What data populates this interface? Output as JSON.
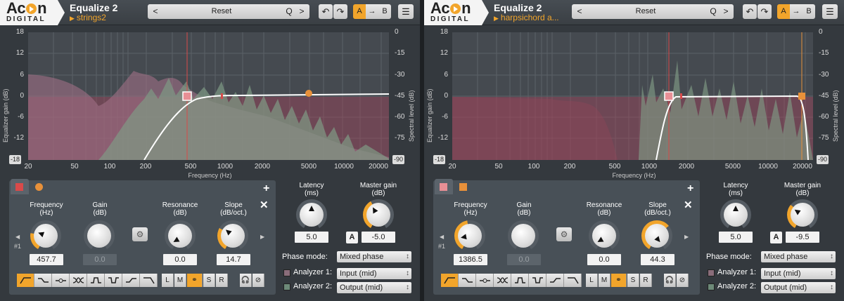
{
  "colors": {
    "accent": "#f2a52b",
    "band1": "#d94a4a",
    "band2": "#e8913a",
    "band1_light": "#e88f95",
    "band2_light": "#e8913a",
    "spectrum_input": "#8a6d7a",
    "spectrum_output": "#6d8a78"
  },
  "scales": {
    "gain_ticks": [
      "18",
      "12",
      "6",
      "0",
      "-6",
      "-12"
    ],
    "gain_bottom": "-18",
    "spectral_ticks": [
      "0",
      "-15",
      "-30",
      "-45",
      "-60",
      "-75"
    ],
    "spectral_bottom": "-90",
    "freq_ticks": [
      "20",
      "50",
      "100",
      "200",
      "500",
      "1000",
      "2000",
      "5000",
      "10000",
      "20000"
    ],
    "gain_axis_label": "Equalizer gain (dB)",
    "spectral_axis_label": "Spectral level (dB)",
    "freq_axis_label": "Frequency (Hz)"
  },
  "common": {
    "logo_main_a": "Ac",
    "logo_main_b": "n",
    "logo_sub": "DIGITAL",
    "app_title": "Equalize 2",
    "reset_label": "Reset",
    "prev_icon": "<",
    "next_icon": ">",
    "search_icon": "Q",
    "undo_icon": "↶",
    "redo_icon": "↷",
    "ab_a": "A",
    "ab_arrow": "→",
    "ab_b": "B",
    "menu_icon": "☰",
    "add_icon": "+",
    "close_icon": "✕",
    "freq_label": "Frequency\n(Hz)",
    "gain_label": "Gain\n(dB)",
    "res_label": "Resonance\n(dB)",
    "slope_label": "Slope\n(dB/oct.)",
    "latency_label": "Latency\n(ms)",
    "master_label": "Master gain\n(dB)",
    "phase_mode_label": "Phase mode:",
    "analyzer1_label": "Analyzer 1:",
    "analyzer2_label": "Analyzer 2:",
    "band_index": "#1",
    "channel_buttons": [
      "L",
      "M",
      "⚭",
      "S",
      "R"
    ],
    "gear_icon": "⚙",
    "a_button": "A",
    "nav_left": "◀",
    "nav_right": "▶"
  },
  "left": {
    "preset": "strings2",
    "frequency": "457.7",
    "gain": "0.0",
    "resonance": "0.0",
    "slope": "14.7",
    "latency": "5.0",
    "master_gain": "-5.0",
    "phase_mode": "Mixed phase",
    "analyzer1": "Input (mid)",
    "analyzer2": "Output (mid)"
  },
  "right": {
    "preset": "harpsichord a...",
    "frequency": "1386.5",
    "gain": "0.0",
    "resonance": "0.0",
    "slope": "44.3",
    "latency": "5.0",
    "master_gain": "-9.5",
    "phase_mode": "Mixed phase",
    "analyzer1": "Input (mid)",
    "analyzer2": "Output (mid)"
  }
}
